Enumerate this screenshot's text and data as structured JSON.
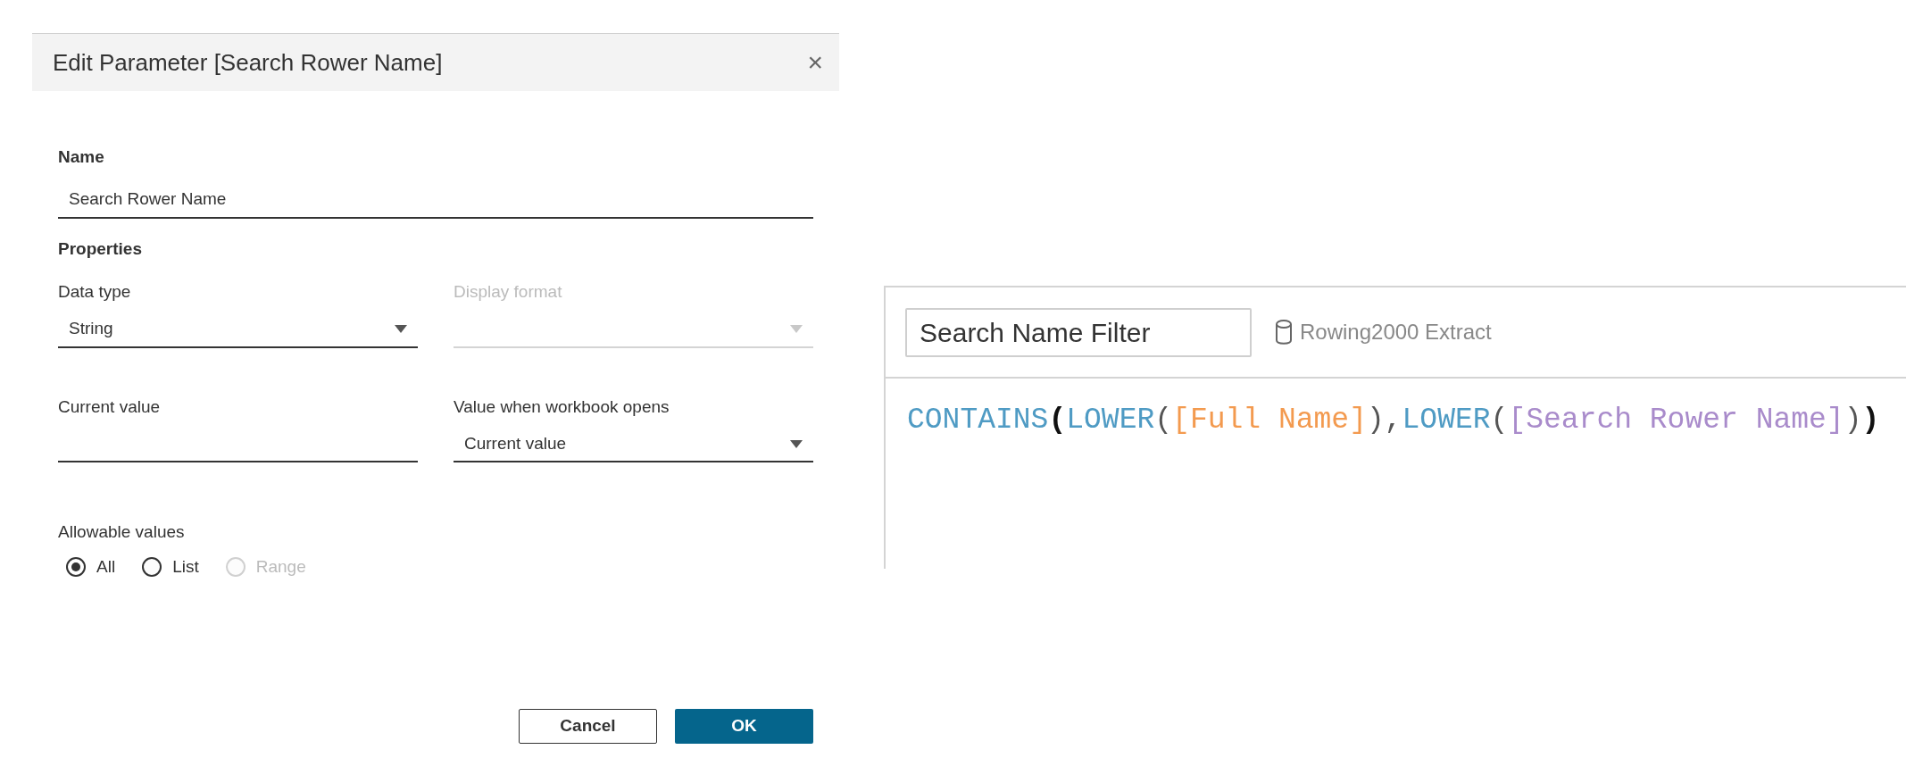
{
  "dialog": {
    "title": "Edit Parameter [Search Rower Name]",
    "close": "×",
    "name_label": "Name",
    "name_value": "Search Rower Name",
    "properties_label": "Properties",
    "data_type": {
      "label": "Data type",
      "value": "String",
      "disabled": false
    },
    "display_format": {
      "label": "Display format",
      "disabled": true
    },
    "current_value": {
      "label": "Current value"
    },
    "value_when_opens": {
      "label": "Value when workbook opens",
      "value": "Current value",
      "disabled": false
    },
    "allowable_values": {
      "label": "Allowable values",
      "options": [
        {
          "label": "All",
          "selected": true,
          "disabled": false
        },
        {
          "label": "List",
          "selected": false,
          "disabled": false
        },
        {
          "label": "Range",
          "selected": false,
          "disabled": true
        }
      ]
    },
    "buttons": [
      {
        "label": "Cancel",
        "kind": "secondary"
      },
      {
        "label": "OK",
        "kind": "primary"
      }
    ]
  },
  "calculation": {
    "name": "Search Name Filter",
    "data_source": "Rowing2000 Extract",
    "formula": [
      {
        "text": "CONTAINS",
        "kind": "function"
      },
      {
        "text": "(",
        "kind": "outer_paren"
      },
      {
        "text": "LOWER",
        "kind": "function"
      },
      {
        "text": "(",
        "kind": "paren"
      },
      {
        "text": "[Full Name]",
        "kind": "field"
      },
      {
        "text": "),",
        "kind": "paren"
      },
      {
        "text": "LOWER",
        "kind": "function"
      },
      {
        "text": "(",
        "kind": "paren"
      },
      {
        "text": "[Search Rower Name]",
        "kind": "parameter"
      },
      {
        "text": ")",
        "kind": "paren"
      },
      {
        "text": ")",
        "kind": "outer_paren"
      }
    ]
  }
}
